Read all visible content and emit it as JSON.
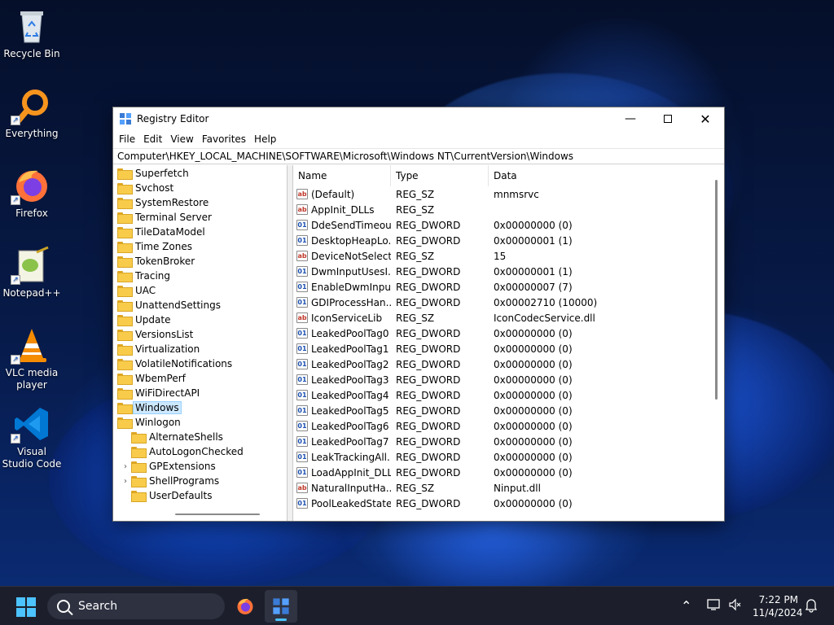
{
  "desktop": {
    "icons": [
      {
        "label": "Recycle Bin",
        "icon": "recycle-bin-icon"
      },
      {
        "label": "Everything",
        "icon": "everything-search-icon"
      },
      {
        "label": "Firefox",
        "icon": "firefox-icon"
      },
      {
        "label": "Notepad++",
        "icon": "notepad-plus-plus-icon"
      },
      {
        "label": "VLC media player",
        "icon": "vlc-icon"
      },
      {
        "label": "Visual Studio Code",
        "icon": "vscode-icon"
      }
    ]
  },
  "window": {
    "title": "Registry Editor",
    "menu": [
      "File",
      "Edit",
      "View",
      "Favorites",
      "Help"
    ],
    "address": "Computer\\HKEY_LOCAL_MACHINE\\SOFTWARE\\Microsoft\\Windows NT\\CurrentVersion\\Windows",
    "tree": [
      {
        "label": "Superfetch"
      },
      {
        "label": "Svchost"
      },
      {
        "label": "SystemRestore"
      },
      {
        "label": "Terminal Server"
      },
      {
        "label": "TileDataModel"
      },
      {
        "label": "Time Zones"
      },
      {
        "label": "TokenBroker"
      },
      {
        "label": "Tracing"
      },
      {
        "label": "UAC"
      },
      {
        "label": "UnattendSettings"
      },
      {
        "label": "Update"
      },
      {
        "label": "VersionsList"
      },
      {
        "label": "Virtualization"
      },
      {
        "label": "VolatileNotifications"
      },
      {
        "label": "WbemPerf"
      },
      {
        "label": "WiFiDirectAPI"
      },
      {
        "label": "Windows"
      },
      {
        "label": "Winlogon"
      },
      {
        "label": "AlternateShells"
      },
      {
        "label": "AutoLogonChecked"
      },
      {
        "label": "GPExtensions"
      },
      {
        "label": "ShellPrograms"
      },
      {
        "label": "UserDefaults"
      }
    ],
    "columns": {
      "name": "Name",
      "type": "Type",
      "data": "Data"
    },
    "values": [
      {
        "name": "(Default)",
        "type": "REG_SZ",
        "data": "mnmsrvc"
      },
      {
        "name": "AppInit_DLLs",
        "type": "REG_SZ",
        "data": ""
      },
      {
        "name": "DdeSendTimeout",
        "type": "REG_DWORD",
        "data": "0x00000000 (0)"
      },
      {
        "name": "DesktopHeapLo...",
        "type": "REG_DWORD",
        "data": "0x00000001 (1)"
      },
      {
        "name": "DeviceNotSelect...",
        "type": "REG_SZ",
        "data": "15"
      },
      {
        "name": "DwmInputUsesI...",
        "type": "REG_DWORD",
        "data": "0x00000001 (1)"
      },
      {
        "name": "EnableDwmInpu...",
        "type": "REG_DWORD",
        "data": "0x00000007 (7)"
      },
      {
        "name": "GDIProcessHan...",
        "type": "REG_DWORD",
        "data": "0x00002710 (10000)"
      },
      {
        "name": "IconServiceLib",
        "type": "REG_SZ",
        "data": "IconCodecService.dll"
      },
      {
        "name": "LeakedPoolTag0",
        "type": "REG_DWORD",
        "data": "0x00000000 (0)"
      },
      {
        "name": "LeakedPoolTag1",
        "type": "REG_DWORD",
        "data": "0x00000000 (0)"
      },
      {
        "name": "LeakedPoolTag2",
        "type": "REG_DWORD",
        "data": "0x00000000 (0)"
      },
      {
        "name": "LeakedPoolTag3",
        "type": "REG_DWORD",
        "data": "0x00000000 (0)"
      },
      {
        "name": "LeakedPoolTag4",
        "type": "REG_DWORD",
        "data": "0x00000000 (0)"
      },
      {
        "name": "LeakedPoolTag5",
        "type": "REG_DWORD",
        "data": "0x00000000 (0)"
      },
      {
        "name": "LeakedPoolTag6",
        "type": "REG_DWORD",
        "data": "0x00000000 (0)"
      },
      {
        "name": "LeakedPoolTag7",
        "type": "REG_DWORD",
        "data": "0x00000000 (0)"
      },
      {
        "name": "LeakTrackingAll...",
        "type": "REG_DWORD",
        "data": "0x00000000 (0)"
      },
      {
        "name": "LoadAppInit_DLLs",
        "type": "REG_DWORD",
        "data": "0x00000000 (0)"
      },
      {
        "name": "NaturalInputHa...",
        "type": "REG_SZ",
        "data": "Ninput.dll"
      },
      {
        "name": "PoolLeakedState",
        "type": "REG_DWORD",
        "data": "0x00000000 (0)"
      }
    ]
  },
  "taskbar": {
    "search_label": "Search",
    "time": "7:22 PM",
    "date": "11/4/2024"
  }
}
